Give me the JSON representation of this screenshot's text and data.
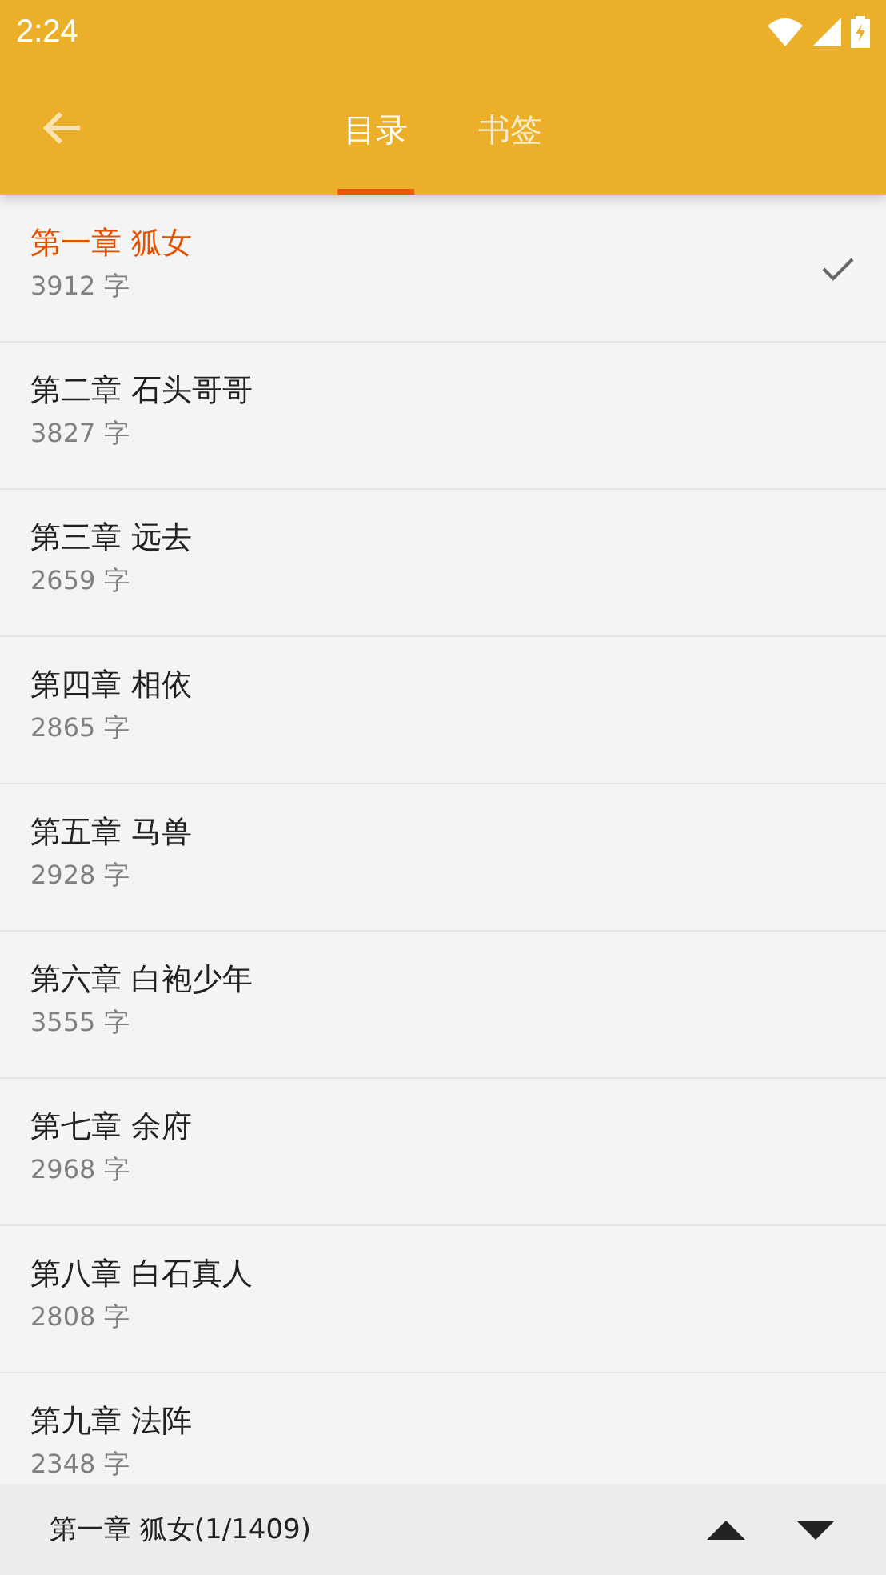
{
  "status_bar": {
    "time": "2:24"
  },
  "tabs": [
    {
      "label": "目录",
      "selected": true
    },
    {
      "label": "书签",
      "selected": false
    }
  ],
  "chapters": [
    {
      "title": "第一章 狐女",
      "count": "3912 字",
      "selected": true
    },
    {
      "title": "第二章 石头哥哥",
      "count": "3827 字",
      "selected": false
    },
    {
      "title": "第三章 远去",
      "count": "2659 字",
      "selected": false
    },
    {
      "title": "第四章 相依",
      "count": "2865 字",
      "selected": false
    },
    {
      "title": "第五章 马兽",
      "count": "2928 字",
      "selected": false
    },
    {
      "title": "第六章 白袍少年",
      "count": "3555 字",
      "selected": false
    },
    {
      "title": "第七章 余府",
      "count": "2968 字",
      "selected": false
    },
    {
      "title": "第八章 白石真人",
      "count": "2808 字",
      "selected": false
    },
    {
      "title": "第九章 法阵",
      "count": "2348 字",
      "selected": false
    }
  ],
  "footer": {
    "current": "第一章 狐女(1/1409)"
  }
}
